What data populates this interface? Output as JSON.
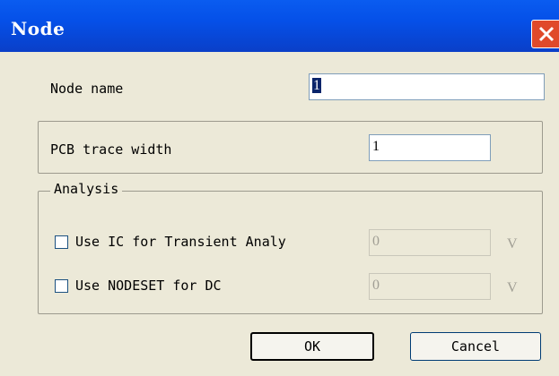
{
  "window": {
    "title": "Node",
    "close_icon": "close-icon"
  },
  "node_name": {
    "label": "Node name",
    "value": "1"
  },
  "pcb": {
    "label": "PCB trace width",
    "value": "1"
  },
  "analysis": {
    "legend": "Analysis",
    "ic": {
      "label": "Use IC for Transient Analy",
      "value": "0",
      "unit": "V",
      "checked": false
    },
    "nodeset": {
      "label": "Use NODESET for DC",
      "value": "0",
      "unit": "V",
      "checked": false
    }
  },
  "buttons": {
    "ok": "OK",
    "cancel": "Cancel"
  },
  "colors": {
    "titlebar": "#0a5cf0",
    "close": "#e0492a",
    "dialog_bg": "#ece9d8"
  }
}
